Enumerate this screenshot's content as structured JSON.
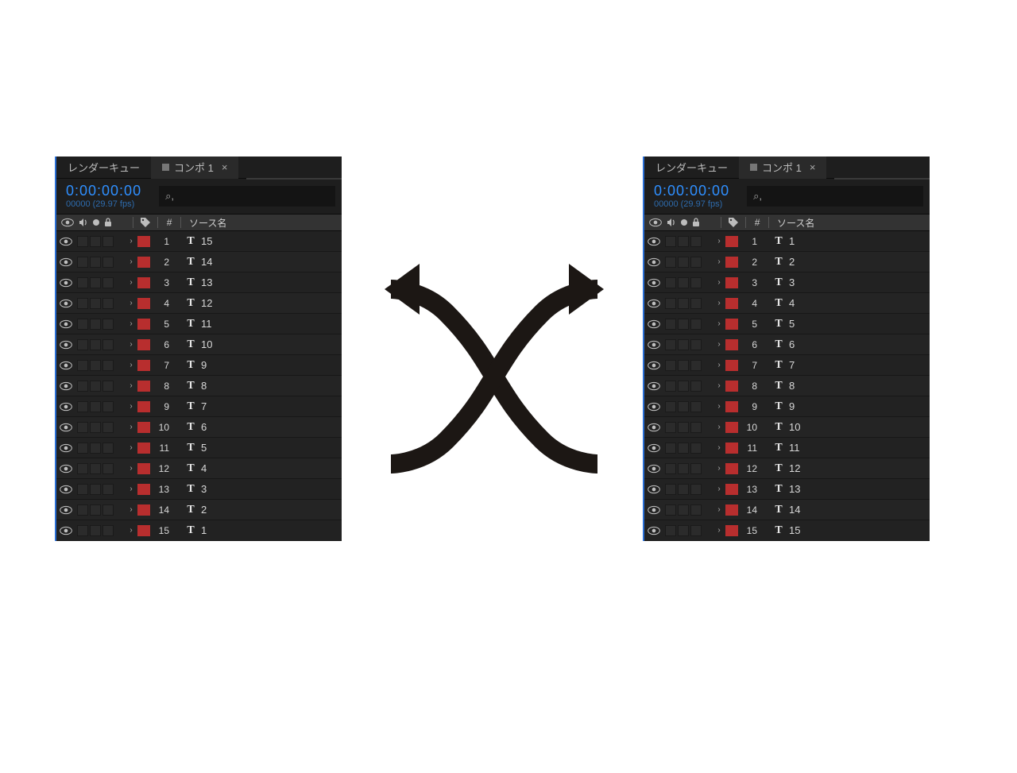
{
  "tabs": {
    "render_queue": "レンダーキュー",
    "comp_label": "コンポ 1"
  },
  "timecode": {
    "value": "0:00:00:00",
    "fps": "00000 (29.97 fps)"
  },
  "search": {
    "glyph": "⌕,"
  },
  "columns": {
    "number": "#",
    "source_name": "ソース名"
  },
  "type_glyph": "T",
  "left_panel": {
    "rows": [
      {
        "index": "1",
        "name": "15"
      },
      {
        "index": "2",
        "name": "14"
      },
      {
        "index": "3",
        "name": "13"
      },
      {
        "index": "4",
        "name": "12"
      },
      {
        "index": "5",
        "name": "11"
      },
      {
        "index": "6",
        "name": "10"
      },
      {
        "index": "7",
        "name": "9"
      },
      {
        "index": "8",
        "name": "8"
      },
      {
        "index": "9",
        "name": "7"
      },
      {
        "index": "10",
        "name": "6"
      },
      {
        "index": "11",
        "name": "5"
      },
      {
        "index": "12",
        "name": "4"
      },
      {
        "index": "13",
        "name": "3"
      },
      {
        "index": "14",
        "name": "2"
      },
      {
        "index": "15",
        "name": "1"
      }
    ]
  },
  "right_panel": {
    "rows": [
      {
        "index": "1",
        "name": "1"
      },
      {
        "index": "2",
        "name": "2"
      },
      {
        "index": "3",
        "name": "3"
      },
      {
        "index": "4",
        "name": "4"
      },
      {
        "index": "5",
        "name": "5"
      },
      {
        "index": "6",
        "name": "6"
      },
      {
        "index": "7",
        "name": "7"
      },
      {
        "index": "8",
        "name": "8"
      },
      {
        "index": "9",
        "name": "9"
      },
      {
        "index": "10",
        "name": "10"
      },
      {
        "index": "11",
        "name": "11"
      },
      {
        "index": "12",
        "name": "12"
      },
      {
        "index": "13",
        "name": "13"
      },
      {
        "index": "14",
        "name": "14"
      },
      {
        "index": "15",
        "name": "15"
      }
    ]
  }
}
